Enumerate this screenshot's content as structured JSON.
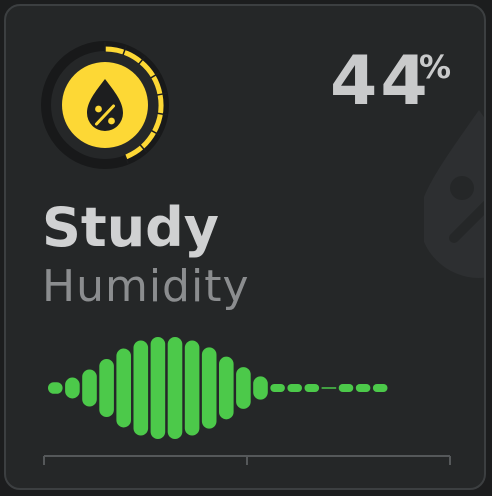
{
  "card": {
    "name": "Study",
    "label": "Humidity",
    "value": "44",
    "unit": "%"
  },
  "ring_level": 0.44,
  "icon": "humidity-drop-percent-icon",
  "colors": {
    "accent": "#fdd835",
    "bars": "#4cc94a",
    "card_background": "#252728",
    "page_background": "#1c1d1e"
  },
  "history": [
    0.1,
    0.18,
    0.32,
    0.5,
    0.68,
    0.82,
    0.88,
    0.88,
    0.82,
    0.7,
    0.54,
    0.36,
    0.2,
    0.04,
    0.03,
    0.03,
    0.0,
    0.04,
    0.04,
    0.04
  ]
}
